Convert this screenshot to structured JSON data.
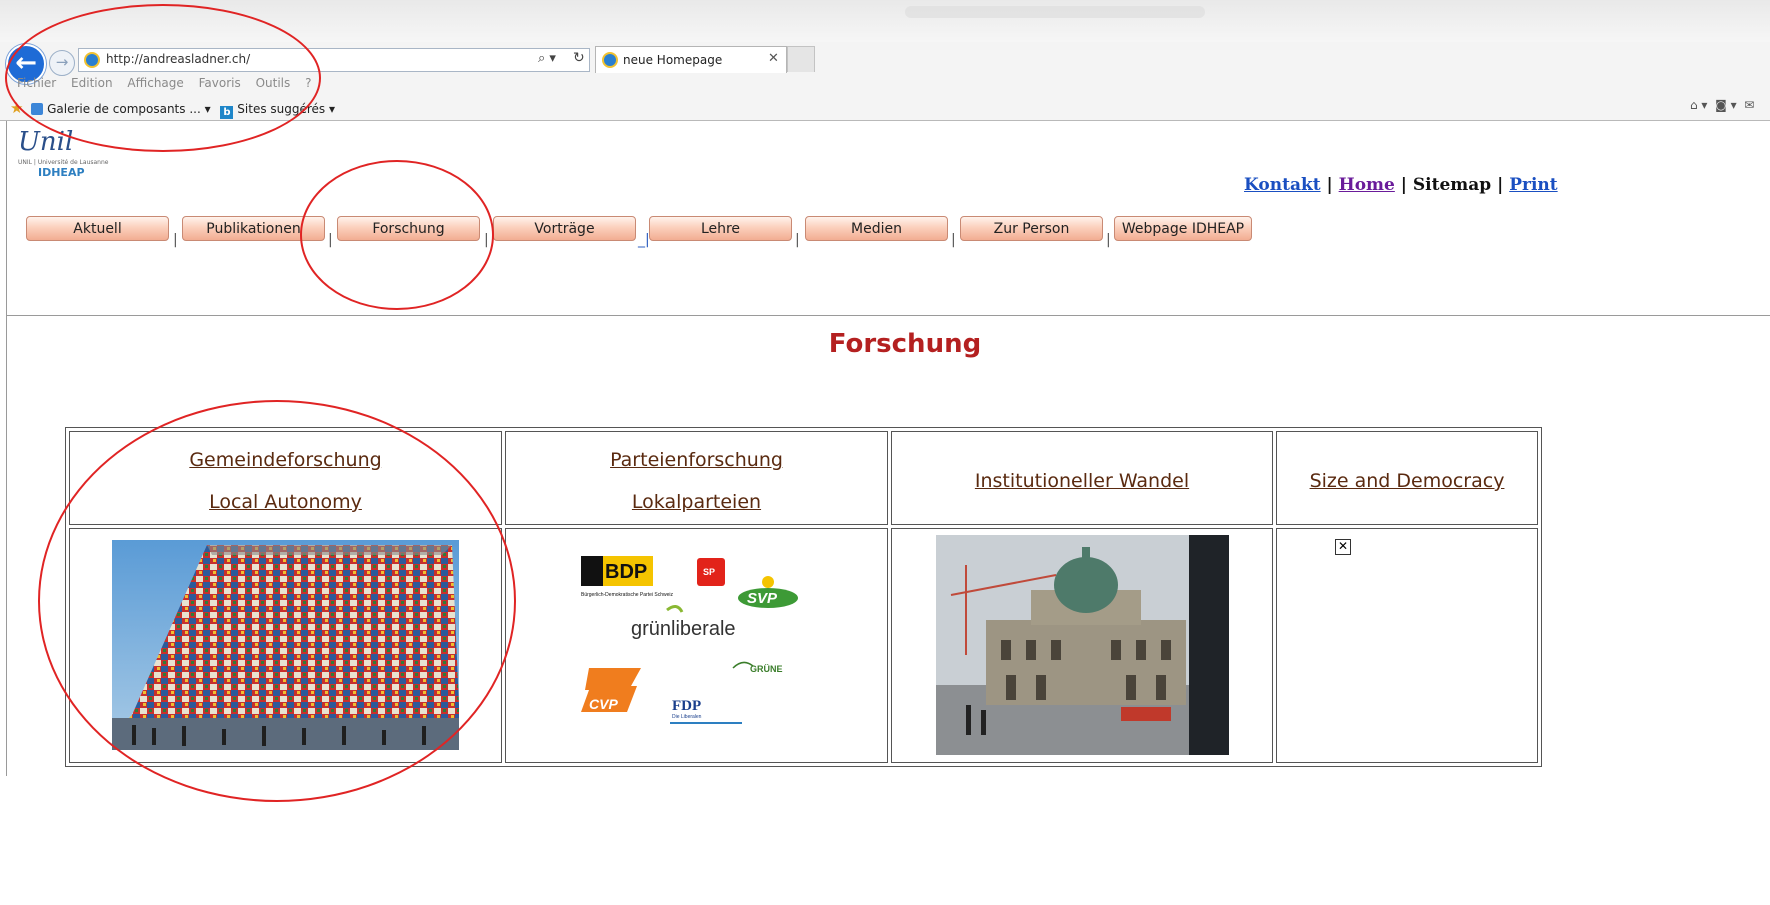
{
  "browser": {
    "address_url": "http://andreasladner.ch/",
    "tab_title": "neue Homepage",
    "menu": [
      "Fichier",
      "Edition",
      "Affichage",
      "Favoris",
      "Outils",
      "?"
    ],
    "favorites": [
      "Galerie de composants ...",
      "Sites suggérés"
    ]
  },
  "logo": {
    "script": "Unil",
    "small": "UNIL | Université de Lausanne",
    "idheap": "IDHEAP"
  },
  "toplinks": {
    "kontakt": "Kontakt",
    "home": "Home",
    "sitemap": "Sitemap",
    "print": "Print",
    "sep": "|"
  },
  "nav": {
    "aktuell": "Aktuell",
    "publikationen": "Publikationen",
    "forschung": "Forschung",
    "vortraege": "Vorträge",
    "lehre": "Lehre",
    "medien": "Medien",
    "zur_person": "Zur Person",
    "webpage_idheap": "Webpage IDHEAP"
  },
  "page": {
    "title": "Forschung"
  },
  "research": {
    "col1_line1": "Gemeindeforschung",
    "col1_line2": "Local Autonomy",
    "col2_line1": "Parteienforschung",
    "col2_line2": "Lokalparteien",
    "col3": "Institutioneller Wandel",
    "col4": "Size and Democracy"
  },
  "party_logos": {
    "bdp": "BDP",
    "bdp_sub": "Bürgerlich-Demokratische Partei Schweiz",
    "sp": "SP",
    "svp": "SVP",
    "gruenliberale": "grünliberale",
    "gruene": "GRÜNE",
    "cvp": "CVP",
    "fdp": "FDP",
    "fdp_sub": "Die Liberalen"
  },
  "colors": {
    "title_red": "#b42020",
    "link_blue": "#1a4fc1",
    "link_visited": "#6a1b9a",
    "annotation_red": "#e02424"
  }
}
